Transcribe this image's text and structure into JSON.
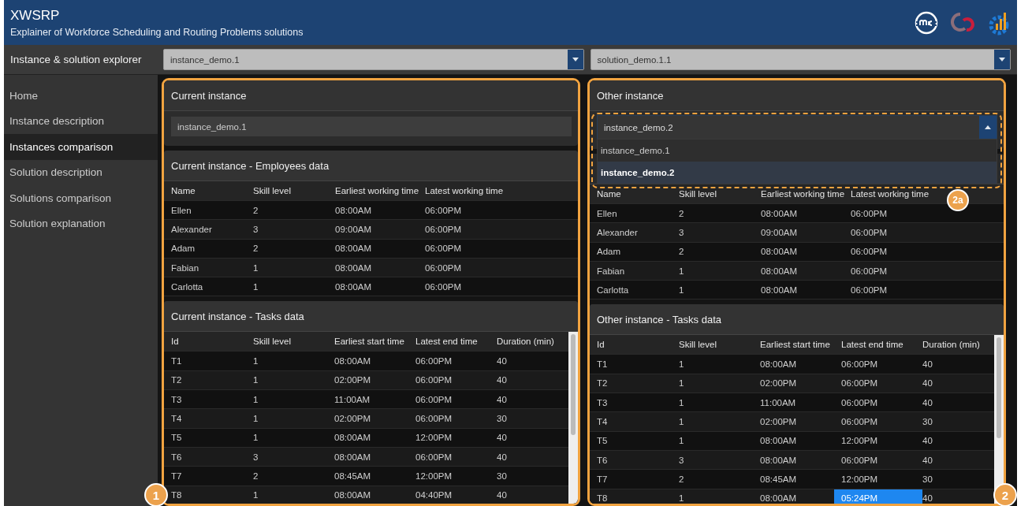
{
  "header": {
    "title": "XWSRP",
    "subtitle": "Explainer of Workforce Scheduling and Routing Problems solutions"
  },
  "toolbar": {
    "label": "Instance & solution explorer",
    "instance_select": {
      "value": "instance_demo.1"
    },
    "solution_select": {
      "value": "solution_demo.1.1"
    }
  },
  "sidebar": {
    "items": [
      {
        "label": "Home",
        "selected": false
      },
      {
        "label": "Instance description",
        "selected": false
      },
      {
        "label": "Instances comparison",
        "selected": true
      },
      {
        "label": "Solution description",
        "selected": false
      },
      {
        "label": "Solutions comparison",
        "selected": false
      },
      {
        "label": "Solution explanation",
        "selected": false
      }
    ]
  },
  "panels": [
    {
      "badge": "1",
      "instance_box": {
        "title": "Current instance",
        "kind": "text",
        "value": "instance_demo.1"
      },
      "employees": {
        "title": "Current instance - Employees data",
        "columns": [
          "Name",
          "Skill level",
          "Earliest working time",
          "Latest working time"
        ],
        "rows": [
          {
            "cells": [
              "Ellen",
              "2",
              "08:00AM",
              "06:00PM"
            ]
          },
          {
            "cells": [
              "Alexander",
              "3",
              "09:00AM",
              "06:00PM"
            ]
          },
          {
            "cells": [
              "Adam",
              "2",
              "08:00AM",
              "06:00PM"
            ]
          },
          {
            "cells": [
              "Fabian",
              "1",
              "08:00AM",
              "06:00PM"
            ]
          },
          {
            "cells": [
              "Carlotta",
              "1",
              "08:00AM",
              "06:00PM"
            ]
          }
        ]
      },
      "tasks": {
        "title": "Current instance - Tasks data",
        "columns": [
          "Id",
          "Skill level",
          "Earliest start time",
          "Latest end time",
          "Duration (min)"
        ],
        "rows": [
          {
            "cells": [
              "T1",
              "1",
              "08:00AM",
              "06:00PM",
              "40"
            ]
          },
          {
            "cells": [
              "T2",
              "1",
              "02:00PM",
              "06:00PM",
              "40"
            ]
          },
          {
            "cells": [
              "T3",
              "1",
              "11:00AM",
              "06:00PM",
              "40"
            ]
          },
          {
            "cells": [
              "T4",
              "1",
              "02:00PM",
              "06:00PM",
              "30"
            ]
          },
          {
            "cells": [
              "T5",
              "1",
              "08:00AM",
              "12:00PM",
              "40"
            ]
          },
          {
            "cells": [
              "T6",
              "3",
              "08:00AM",
              "06:00PM",
              "40"
            ]
          },
          {
            "cells": [
              "T7",
              "2",
              "08:45AM",
              "12:00PM",
              "30"
            ]
          },
          {
            "cells": [
              "T8",
              "1",
              "08:00AM",
              "04:40PM",
              "40"
            ]
          }
        ]
      }
    },
    {
      "badge": "2",
      "instance_box": {
        "title": "Other instance",
        "kind": "dropdown",
        "value": "instance_demo.2",
        "expanded": true,
        "badge": "2a",
        "options": [
          {
            "label": "instance_demo.1",
            "selected": false
          },
          {
            "label": "instance_demo.2",
            "selected": true
          }
        ]
      },
      "employees": {
        "columns": [
          "Name",
          "Skill level",
          "Earliest working time",
          "Latest working time"
        ],
        "rows": [
          {
            "cells": [
              "Ellen",
              "2",
              "08:00AM",
              "06:00PM"
            ]
          },
          {
            "cells": [
              "Alexander",
              "3",
              "09:00AM",
              "06:00PM"
            ]
          },
          {
            "cells": [
              "Adam",
              "2",
              "08:00AM",
              "06:00PM"
            ]
          },
          {
            "cells": [
              "Fabian",
              "1",
              "08:00AM",
              "06:00PM"
            ]
          },
          {
            "cells": [
              "Carlotta",
              "1",
              "08:00AM",
              "06:00PM"
            ]
          }
        ]
      },
      "tasks": {
        "title": "Other instance - Tasks data",
        "columns": [
          "Id",
          "Skill level",
          "Earliest start time",
          "Latest end time",
          "Duration (min)"
        ],
        "rows": [
          {
            "cells": [
              "T1",
              "1",
              "08:00AM",
              "06:00PM",
              "40"
            ]
          },
          {
            "cells": [
              "T2",
              "1",
              "02:00PM",
              "06:00PM",
              "40"
            ]
          },
          {
            "cells": [
              "T3",
              "1",
              "11:00AM",
              "06:00PM",
              "40"
            ]
          },
          {
            "cells": [
              "T4",
              "1",
              "02:00PM",
              "06:00PM",
              "30"
            ]
          },
          {
            "cells": [
              "T5",
              "1",
              "08:00AM",
              "12:00PM",
              "40"
            ]
          },
          {
            "cells": [
              "T6",
              "3",
              "08:00AM",
              "06:00PM",
              "40"
            ]
          },
          {
            "cells": [
              "T7",
              "2",
              "08:45AM",
              "12:00PM",
              "30"
            ]
          },
          {
            "cells": [
              "T8",
              "1",
              "08:00AM",
              "05:24PM",
              "40"
            ],
            "highlighted": [
              false,
              false,
              false,
              true,
              false
            ]
          }
        ]
      }
    }
  ]
}
